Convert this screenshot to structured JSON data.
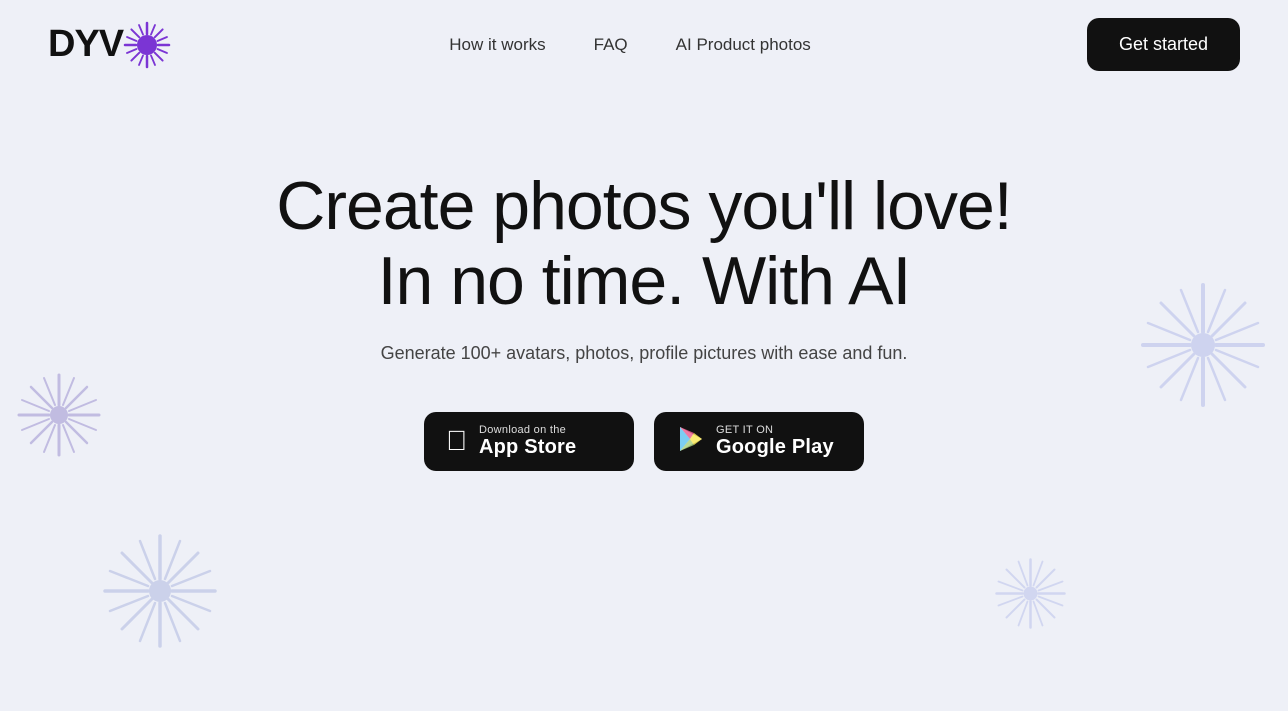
{
  "logo": {
    "text": "DYV",
    "alt": "DYVO"
  },
  "nav": {
    "links": [
      {
        "id": "how-it-works",
        "label": "How it works"
      },
      {
        "id": "faq",
        "label": "FAQ"
      },
      {
        "id": "ai-product-photos",
        "label": "AI Product photos"
      }
    ],
    "cta_label": "Get started"
  },
  "hero": {
    "title_line1": "Create photos you'll love!",
    "title_line2": "In no time. With AI",
    "subtitle": "Generate 100+ avatars, photos, profile pictures with ease and fun.",
    "app_store": {
      "sub": "Download on the",
      "main": "App Store",
      "icon": ""
    },
    "google_play": {
      "sub": "GET IT ON",
      "main": "Google Play",
      "icon": "▶"
    }
  },
  "colors": {
    "bg": "#eef0f7",
    "burst_purple": "#7655d4",
    "burst_light": "#b0b8e8",
    "dark": "#111111",
    "text": "#333333"
  }
}
